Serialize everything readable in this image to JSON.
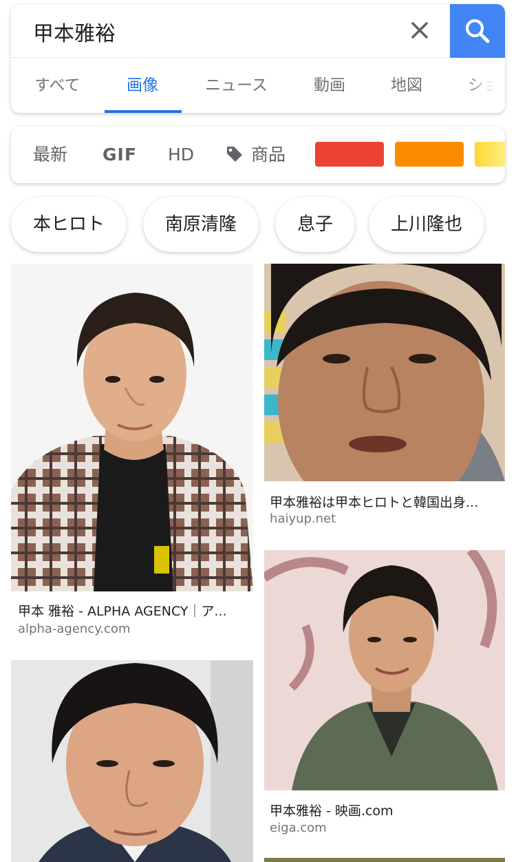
{
  "search": {
    "query": "甲本雅裕"
  },
  "tabs": [
    {
      "label": "すべて"
    },
    {
      "label": "画像"
    },
    {
      "label": "ニュース"
    },
    {
      "label": "動画"
    },
    {
      "label": "地図"
    },
    {
      "label": "ショ"
    }
  ],
  "active_tab": "画像",
  "filters": {
    "latest": "最新",
    "gif": "GIF",
    "hd": "HD",
    "products": "商品",
    "colors": [
      "#ea4335",
      "#fb8c00",
      "#fdd835"
    ]
  },
  "chips": [
    {
      "label": "本ヒロト"
    },
    {
      "label": "南原清隆"
    },
    {
      "label": "息子"
    },
    {
      "label": "上川隆也"
    }
  ],
  "results": [
    {
      "caption": "甲本 雅裕 - ALPHA AGENCY｜ア...",
      "domain": "alpha-agency.com"
    },
    {
      "caption": "甲本雅裕は甲本ヒロトと韓国出身...",
      "domain": "haiyup.net"
    },
    {
      "caption": "甲本雅裕 - 映画.com",
      "domain": "eiga.com"
    },
    {
      "caption": "",
      "domain": ""
    }
  ]
}
